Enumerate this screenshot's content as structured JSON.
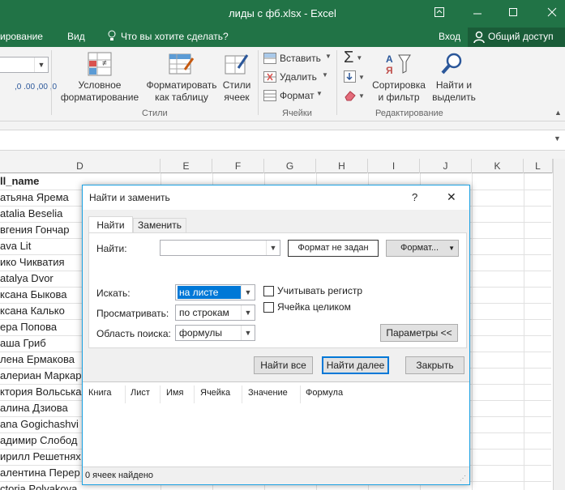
{
  "titlebar": {
    "title": "лиды с фб.xlsx - Excel"
  },
  "menubar": {
    "tab_review": "ирование",
    "tab_view": "Вид",
    "tell_me": "Что вы хотите сделать?",
    "sign_in": "Вход",
    "share": "Общий доступ"
  },
  "ribbon": {
    "conditional_formatting": [
      "Условное",
      "форматирование"
    ],
    "format_as_table": [
      "Форматировать",
      "как таблицу"
    ],
    "cell_styles": [
      "Стили",
      "ячеек"
    ],
    "group_styles": "Стили",
    "insert": "Вставить",
    "delete": "Удалить",
    "format": "Формат",
    "group_cells": "Ячейки",
    "sort_filter": [
      "Сортировка",
      "и фильтр"
    ],
    "find_select": [
      "Найти и",
      "выделить"
    ],
    "group_editing": "Редактирование",
    "number_buttons": [
      ",0 .00",
      ",00 ,0"
    ]
  },
  "sheet": {
    "columns": [
      "D",
      "E",
      "F",
      "G",
      "H",
      "I",
      "J",
      "K",
      "L"
    ],
    "rows": [
      "ll_name",
      "атьяна Ярема",
      "atalia Beselia",
      "вгения Гончар",
      "ava Lit",
      "ико Чикватия",
      "atalya Dvor",
      "ксана Быкова",
      "ксана Калько",
      "ера Попова",
      "аша Гриб",
      "лена Ермакова",
      "алериан Маркар",
      "ктория Вольська",
      "алина Дзиова",
      "ana Gogichashvi",
      "адимир Слобод",
      "ирилл Решетнях",
      "алентина Перер",
      "ctoria Polyakova"
    ]
  },
  "dialog": {
    "title": "Найти и заменить",
    "help": "?",
    "close_x": "✕",
    "tab_find": "Найти",
    "tab_replace": "Заменить",
    "find_label": "Найти:",
    "find_value": "",
    "format_not_set": "Формат не задан",
    "format_button": "Формат...",
    "within_label": "Искать:",
    "within_value": "на листе",
    "search_label": "Просматривать:",
    "search_value": "по строкам",
    "lookin_label": "Область поиска:",
    "lookin_value": "формулы",
    "match_case": "Учитывать регистр",
    "match_entire": "Ячейка целиком",
    "options_button": "Параметры <<",
    "find_all": "Найти все",
    "find_next": "Найти далее",
    "close": "Закрыть",
    "results_headers": [
      "Книга",
      "Лист",
      "Имя",
      "Ячейка",
      "Значение",
      "Формула"
    ],
    "status": "0 ячеек найдено"
  },
  "colors": {
    "excel_green": "#217346",
    "dialog_accent": "#1ba1e2",
    "selection_blue": "#0078d7"
  }
}
